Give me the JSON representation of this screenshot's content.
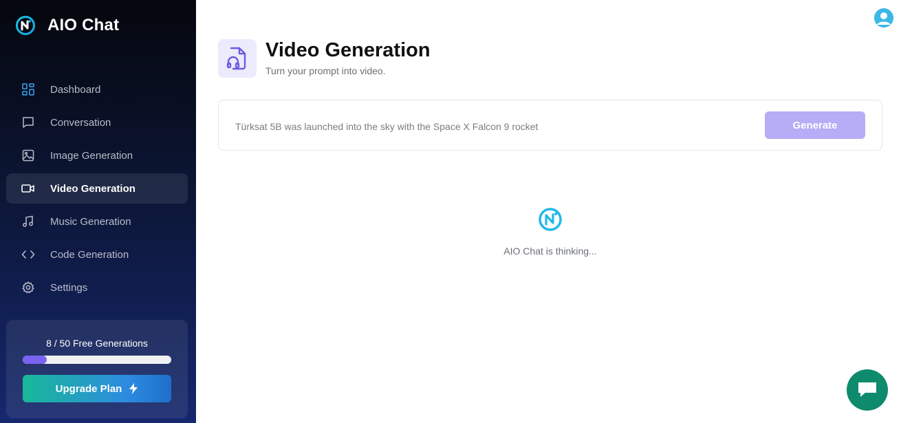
{
  "app": {
    "name": "AIO Chat"
  },
  "sidebar": {
    "items": [
      {
        "label": "Dashboard",
        "icon": "dashboard-icon",
        "active": false
      },
      {
        "label": "Conversation",
        "icon": "chat-bubble-icon",
        "active": false
      },
      {
        "label": "Image Generation",
        "icon": "image-icon",
        "active": false
      },
      {
        "label": "Video Generation",
        "icon": "video-camera-icon",
        "active": true
      },
      {
        "label": "Music Generation",
        "icon": "music-note-icon",
        "active": false
      },
      {
        "label": "Code Generation",
        "icon": "code-icon",
        "active": false
      },
      {
        "label": "Settings",
        "icon": "gear-icon",
        "active": false
      }
    ],
    "usage": {
      "text": "8 / 50 Free Generations",
      "used": 8,
      "total": 50
    },
    "upgrade_label": "Upgrade Plan"
  },
  "header": {
    "title": "Video Generation",
    "subtitle": "Turn your prompt into video."
  },
  "prompt": {
    "value": "Türksat 5B was launched into the sky with the Space X Falcon 9 rocket",
    "generate_label": "Generate"
  },
  "status": {
    "text": "AIO Chat is thinking..."
  },
  "colors": {
    "accent": "#7b63f2",
    "generate_disabled": "#b6adf6",
    "fab": "#0e8a6c"
  }
}
